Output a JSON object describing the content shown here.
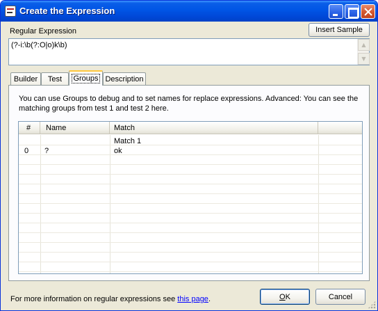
{
  "window": {
    "title": "Create the Expression",
    "minimize_icon": "minimize-icon",
    "maximize_icon": "maximize-icon",
    "close_icon": "close-icon"
  },
  "regex_section": {
    "label": "Regular Expression",
    "insert_sample_label": "Insert Sample",
    "value": "(?-i:\\b(?:O|o)k\\b)"
  },
  "tabs": [
    {
      "label": "Builder",
      "active": false
    },
    {
      "label": "Test",
      "active": false
    },
    {
      "label": "Groups",
      "active": true
    },
    {
      "label": "Description",
      "active": false
    }
  ],
  "groups_panel": {
    "description": "You can use Groups to debug and to set names for replace expressions.  Advanced: You can see the matching groups from test 1 and test 2 here.",
    "columns": [
      "#",
      "Name",
      "Match"
    ],
    "rows": [
      {
        "num": "",
        "name": "",
        "match": "Match 1"
      },
      {
        "num": "0",
        "name": "?",
        "match": "ok"
      }
    ]
  },
  "footer": {
    "info_text": "For more information on regular expressions see ",
    "link_text": "this page",
    "suffix": "."
  },
  "buttons": {
    "ok_label": "OK",
    "ok_accel": "O",
    "ok_rest": "K",
    "cancel_label": "Cancel"
  },
  "colors": {
    "titlebar": "#0055e5",
    "dialog_bg": "#ece9d8",
    "active_tab_highlight": "#ffc73c",
    "link": "#0000ff"
  }
}
